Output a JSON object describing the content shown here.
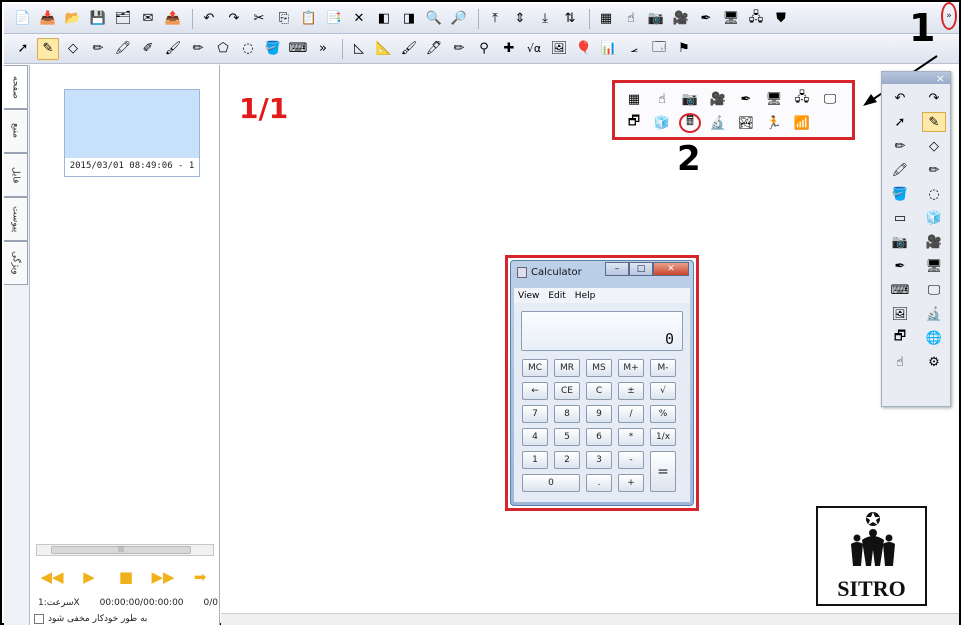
{
  "toolbar_top": {
    "icons": [
      "new-page-icon",
      "import-icon",
      "open-folder-icon",
      "save-icon",
      "save-as-icon",
      "email-icon",
      "export-icon",
      "undo-icon",
      "redo-icon",
      "cut-icon",
      "copy-icon",
      "paste-icon",
      "paste-special-icon",
      "delete-icon",
      "prev-icon",
      "next-icon",
      "zoom-in-icon",
      "zoom-out-icon",
      "align-top-icon",
      "align-middle-icon",
      "align-bottom-icon",
      "reorder-icon",
      "screen-capture-icon",
      "hand-pointer-icon",
      "camera-icon",
      "video-recorder-icon",
      "pen-icon",
      "projector-icon",
      "network-icon",
      "fold-icon"
    ]
  },
  "toolbar_second": {
    "icons": [
      "select-icon",
      "pen-yellow-icon",
      "eraser-icon",
      "pen-red-icon",
      "highlighter-icon",
      "pen-green-icon",
      "brush-icon",
      "pencil-blue-icon",
      "shape-icon",
      "lasso-icon",
      "fill-icon",
      "keyboard-icon",
      "triangle-icon",
      "ruler-icon",
      "brush-orange-icon",
      "marker-icon",
      "pencil-yellow-icon",
      "compass-icon",
      "axis-icon",
      "formula-icon",
      "image-icon",
      "balloon-icon",
      "chart-icon",
      "protractor-icon",
      "window-icon",
      "flag-icon"
    ],
    "overflow_label": "»",
    "formula_label": "√α"
  },
  "left_tabs": [
    "صفحه",
    "منبع",
    "فایل",
    "پیوست",
    "ویژگی"
  ],
  "thumbnail": {
    "caption": "2015/03/01 08:49:06 - 1"
  },
  "playback": {
    "speed_text": "سرعت:1X",
    "time_text": "00:00:00/00:00:00",
    "count_text": "0/0",
    "auto_hide_text": "به طور خودکار مخفی شود"
  },
  "page_indicator": "1/1",
  "annotations": {
    "marker_1": "1",
    "marker_2": "2",
    "overflow_glyph": "»"
  },
  "popup_toolbar": {
    "icons": [
      "screen-capture-icon",
      "hand-pointer-icon",
      "camera-icon",
      "video-recorder-icon",
      "pen-icon",
      "projector-icon",
      "network-icon",
      "monitor-icon",
      "screen-icon",
      "cube-icon",
      "calculator-icon",
      "magnifier-icon",
      "pictures-icon",
      "stick-figure-icon",
      "stairs-icon"
    ]
  },
  "float_palette": {
    "close_label": "×",
    "icons": [
      "undo-icon",
      "redo-icon",
      "select-icon",
      "pen-yellow-icon",
      "pen-red-icon",
      "eraser-icon",
      "highlighter-icon",
      "pencil-blue-icon",
      "fill-icon",
      "lasso-icon",
      "rectangle-icon",
      "cube-icon",
      "camera-icon",
      "video-recorder-icon",
      "pen-icon",
      "projector-icon",
      "keyboard-icon",
      "monitor-icon",
      "image-icon",
      "magnifier-icon",
      "screen-icon",
      "globe-icon",
      "hand-pointer-icon",
      "settings-icon"
    ]
  },
  "calculator": {
    "title": "Calculator",
    "menu": [
      "View",
      "Edit",
      "Help"
    ],
    "display": "0",
    "keys": [
      "MC",
      "MR",
      "MS",
      "M+",
      "M-",
      "←",
      "CE",
      "C",
      "±",
      "√",
      "7",
      "8",
      "9",
      "/",
      "%",
      "4",
      "5",
      "6",
      "*",
      "1/x",
      "1",
      "2",
      "3",
      "-",
      "=",
      "0",
      ".",
      "+"
    ]
  },
  "logo": {
    "text": "SITRO"
  },
  "colors": {
    "annotation_red": "#d7262b",
    "page_number_red": "#e11b1b",
    "thumb_blue": "#c8e1fb",
    "toolbar_bg": "#dde3ee"
  }
}
